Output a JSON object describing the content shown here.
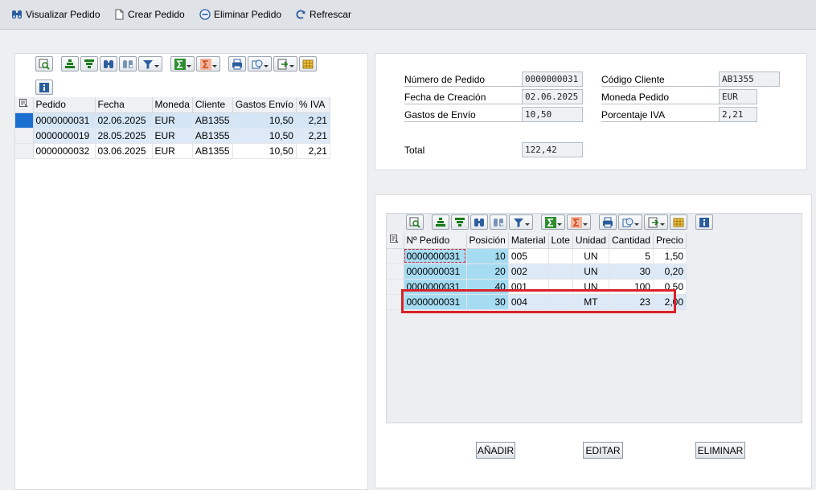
{
  "toolbar": {
    "view_label": "Visualizar Pedido",
    "create_label": "Crear Pedido",
    "delete_label": "Eliminar Pedido",
    "refresh_label": "Refrescar"
  },
  "orders_grid": {
    "columns": [
      "Pedido",
      "Fecha",
      "Moneda",
      "Cliente",
      "Gastos Envío",
      "% IVA"
    ],
    "rows": [
      [
        "0000000031",
        "02.06.2025",
        "EUR",
        "AB1355",
        "10,50",
        "2,21"
      ],
      [
        "0000000019",
        "28.05.2025",
        "EUR",
        "AB1355",
        "10,50",
        "2,21"
      ],
      [
        "0000000032",
        "03.06.2025",
        "EUR",
        "AB1355",
        "10,50",
        "2,21"
      ]
    ]
  },
  "header_form": {
    "numero_pedido_label": "Número de Pedido",
    "numero_pedido_value": "0000000031",
    "fecha_creacion_label": "Fecha de Creación",
    "fecha_creacion_value": "02.06.2025",
    "gastos_envio_label": "Gastos de Envío",
    "gastos_envio_value": "10,50",
    "codigo_cliente_label": "Código Cliente",
    "codigo_cliente_value": "AB1355",
    "moneda_pedido_label": "Moneda Pedido",
    "moneda_pedido_value": "EUR",
    "porcentaje_iva_label": "Porcentaje IVA",
    "porcentaje_iva_value": "2,21",
    "total_label": "Total",
    "total_value": "122,42"
  },
  "items_grid": {
    "columns": [
      "Nº Pedido",
      "Posición",
      "Material",
      "Lote",
      "Unidad",
      "Cantidad",
      "Precio"
    ],
    "rows": [
      [
        "0000000031",
        "10",
        "005",
        "",
        "UN",
        "5",
        "1,50"
      ],
      [
        "0000000031",
        "20",
        "002",
        "",
        "UN",
        "30",
        "0,20"
      ],
      [
        "0000000031",
        "40",
        "001",
        "",
        "UN",
        "100",
        "0,50"
      ],
      [
        "0000000031",
        "30",
        "004",
        "",
        "MT",
        "23",
        "2,00"
      ]
    ]
  },
  "actions": {
    "add_label": "AÑADIR",
    "edit_label": "EDITAR",
    "delete_label": "ELIMINAR"
  },
  "icons": [
    "binoculars-icon",
    "document-icon",
    "delete-circle-icon",
    "refresh-icon",
    "details-icon",
    "sort-asc-icon",
    "sort-desc-icon",
    "find-icon",
    "find-next-icon",
    "filter-icon",
    "sum-icon",
    "subtotal-icon",
    "print-icon",
    "views-icon",
    "export-icon",
    "layout-icon",
    "info-icon"
  ],
  "colors": {
    "selection": "#1b6fd1",
    "key_column": "#a6dcf2",
    "highlight_border": "#d9222a"
  }
}
